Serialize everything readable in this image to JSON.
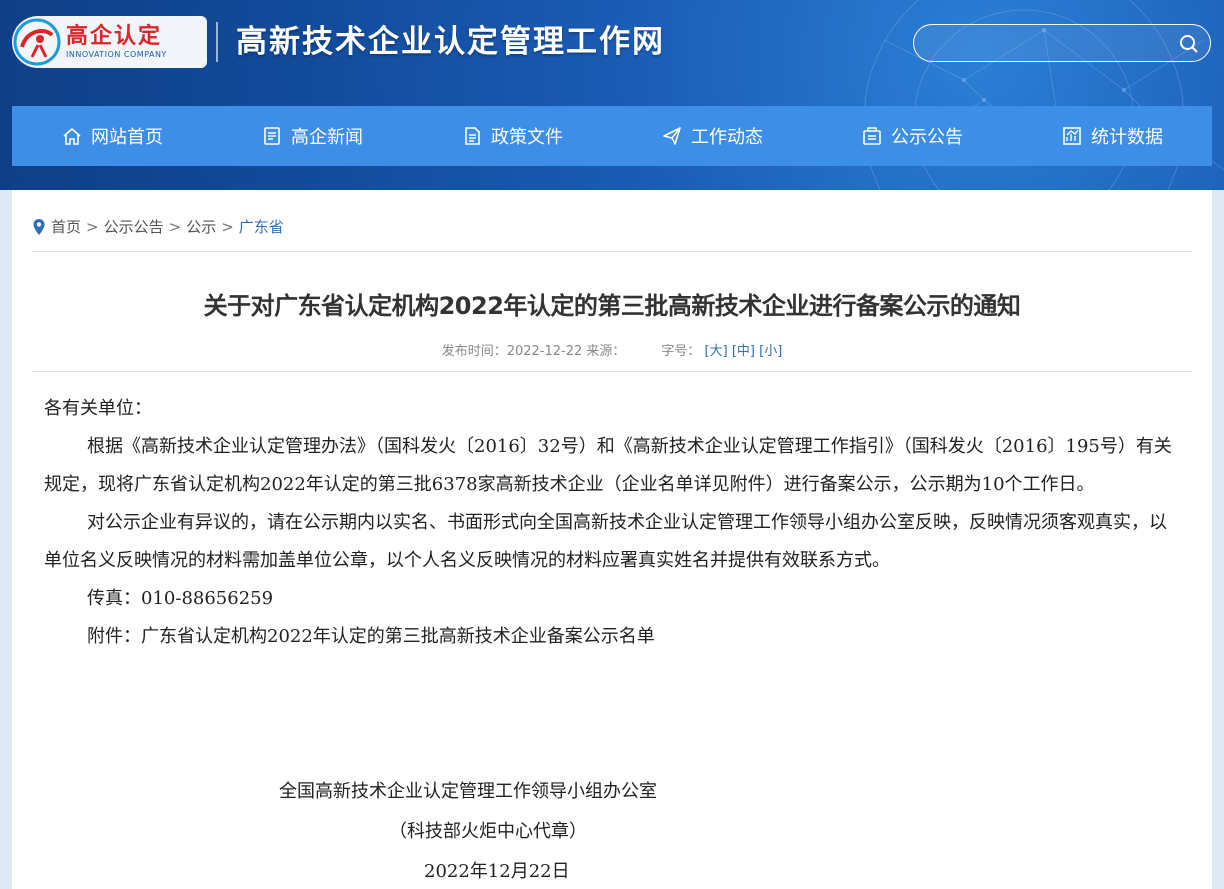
{
  "header": {
    "logo_cn": "高企认定",
    "logo_en": "INNOVATION COMPANY",
    "site_title": "高新技术企业认定管理工作网",
    "search_placeholder": ""
  },
  "nav": {
    "items": [
      {
        "label": "网站首页",
        "icon": "home-icon"
      },
      {
        "label": "高企新闻",
        "icon": "news-icon"
      },
      {
        "label": "政策文件",
        "icon": "document-icon"
      },
      {
        "label": "工作动态",
        "icon": "paper-plane-icon"
      },
      {
        "label": "公示公告",
        "icon": "announcement-icon"
      },
      {
        "label": "统计数据",
        "icon": "chart-icon"
      }
    ]
  },
  "breadcrumb": {
    "items": [
      "首页",
      "公示公告",
      "公示"
    ],
    "separator": ">",
    "current": "广东省"
  },
  "article": {
    "title": "关于对广东省认定机构2022年认定的第三批高新技术企业进行备案公示的通知",
    "meta_time": "发布时间：2022-12-22 来源：",
    "font_size_label": "字号：",
    "font_large": "[大]",
    "font_medium": "[中]",
    "font_small": "[小]",
    "salutation": "各有关单位：",
    "para1": "根据《高新技术企业认定管理办法》（国科发火〔2016〕32号）和《高新技术企业认定管理工作指引》（国科发火〔2016〕195号）有关规定，现将广东省认定机构2022年认定的第三批6378家高新技术企业（企业名单详见附件）进行备案公示，公示期为10个工作日。",
    "para2": "对公示企业有异议的，请在公示期内以实名、书面形式向全国高新技术企业认定管理工作领导小组办公室反映，反映情况须客观真实，以单位名义反映情况的材料需加盖单位公章，以个人名义反映情况的材料应署真实姓名并提供有效联系方式。",
    "fax": "传真：010-88656259",
    "attachment_label": "附件：",
    "attachment_link": "广东省认定机构2022年认定的第三批高新技术企业备案公示名单",
    "signature_org": "全国高新技术企业认定管理工作领导小组办公室",
    "signature_sub": "（科技部火炬中心代章）",
    "signature_date": "2022年12月22日"
  },
  "colors": {
    "header_blue": "#1b5cb5",
    "nav_blue": "#3d8ee6",
    "link_blue": "#2f6fb8",
    "logo_red": "#d9262a"
  }
}
